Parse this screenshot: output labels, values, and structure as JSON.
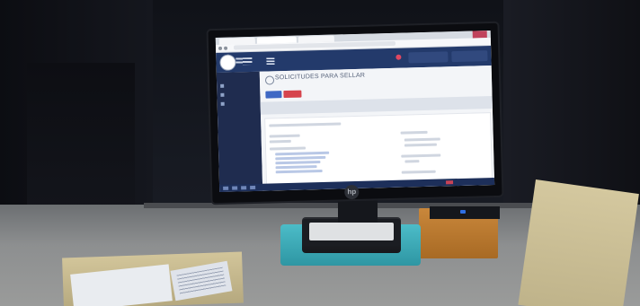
{
  "browser": {
    "tabs": [
      {
        "label": ""
      },
      {
        "label": ""
      },
      {
        "label": ""
      }
    ]
  },
  "header": {
    "user_label": "",
    "version_label": ""
  },
  "page": {
    "title": "SOLICITUDES PARA SELLAR",
    "primary_button": "",
    "danger_button": ""
  },
  "sidebar": {
    "items": [
      {
        "label": ""
      },
      {
        "label": ""
      },
      {
        "label": ""
      }
    ]
  },
  "colors": {
    "header": "#233a6b",
    "sidebar": "#1f2c4f",
    "button_primary": "#3f68c4",
    "button_danger": "#d6444d",
    "tray": "#2e96a3",
    "folder_label": "#c23a3a"
  },
  "icons": {
    "monitor_logo": "hp-logo-icon",
    "menu": "hamburger-icon",
    "notification": "bell-icon"
  }
}
